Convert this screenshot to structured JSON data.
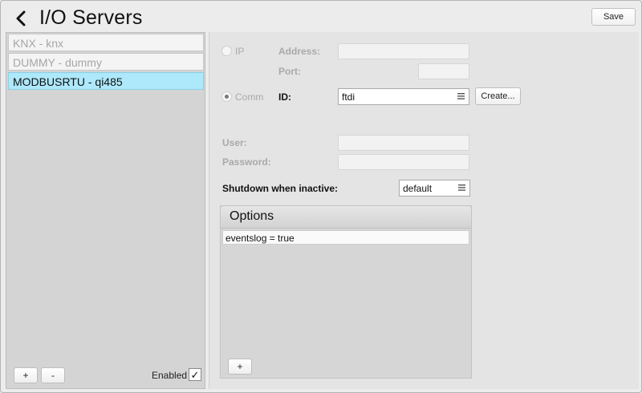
{
  "header": {
    "title": "I/O Servers",
    "save_label": "Save"
  },
  "servers": [
    {
      "label": "KNX - knx",
      "selected": false
    },
    {
      "label": "DUMMY - dummy",
      "selected": false
    },
    {
      "label": "MODBUSRTU - qi485",
      "selected": true
    }
  ],
  "left_footer": {
    "add_label": "+",
    "remove_label": "-",
    "enabled_label": "Enabled",
    "enabled_checked": true,
    "check_glyph": "✓"
  },
  "connection": {
    "ip_label": "IP",
    "ip_selected": false,
    "address_label": "Address:",
    "address_value": "",
    "port_label": "Port:",
    "port_value": "",
    "comm_label": "Comm",
    "comm_selected": true,
    "id_label": "ID:",
    "id_value": "ftdi",
    "create_label": "Create..."
  },
  "credentials": {
    "user_label": "User:",
    "user_value": "",
    "password_label": "Password:",
    "password_value": ""
  },
  "shutdown": {
    "label": "Shutdown when inactive:",
    "value": "default"
  },
  "options": {
    "title": "Options",
    "items": [
      "eventslog = true"
    ],
    "add_label": "+"
  },
  "colors": {
    "selected_row": "#ade8fb",
    "disabled_text": "#a6a6a6"
  }
}
